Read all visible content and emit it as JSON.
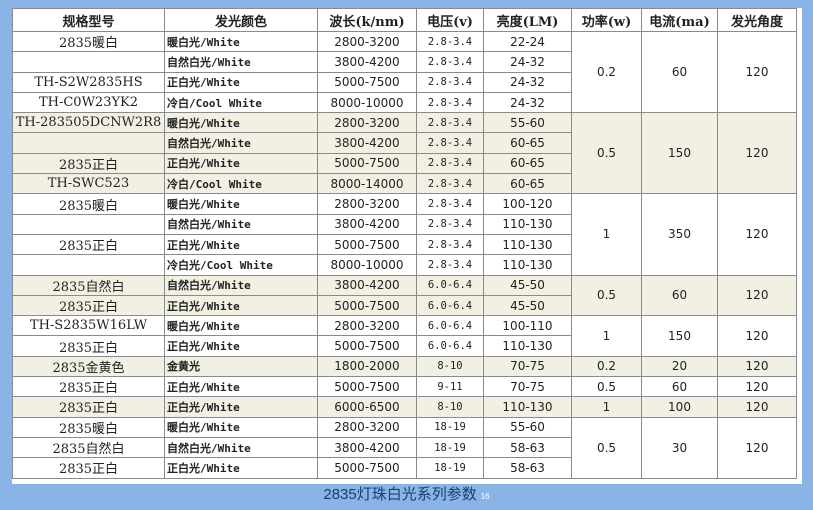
{
  "headers": [
    "规格型号",
    "发光颜色",
    "波长(k/nm)",
    "电压(v)",
    "亮度(LM)",
    "功率(w)",
    "电流(ma)",
    "发光角度"
  ],
  "groups": [
    {
      "power": "0.2",
      "current": "60",
      "angle": "120",
      "rows": [
        {
          "model": "2835暖白",
          "color": "暖白光/White",
          "wave": "2800-3200",
          "volt": "2.8-3.4",
          "lum": "22-24"
        },
        {
          "model": "",
          "color": "自然白光/White",
          "wave": "3800-4200",
          "volt": "2.8-3.4",
          "lum": "24-32"
        },
        {
          "model": "TH-S2W2835HS",
          "color": "正白光/White",
          "wave": "5000-7500",
          "volt": "2.8-3.4",
          "lum": "24-32"
        },
        {
          "model": "TH-C0W23YK2",
          "color": "冷白/Cool White",
          "wave": "8000-10000",
          "volt": "2.8-3.4",
          "lum": "24-32"
        }
      ]
    },
    {
      "power": "0.5",
      "current": "150",
      "angle": "120",
      "rows": [
        {
          "model": "TH-283505DCNW2R8",
          "color": "暖白光/White",
          "wave": "2800-3200",
          "volt": "2.8-3.4",
          "lum": "55-60"
        },
        {
          "model": "",
          "color": "自然白光/White",
          "wave": "3800-4200",
          "volt": "2.8-3.4",
          "lum": "60-65"
        },
        {
          "model": "2835正白",
          "color": "正白光/White",
          "wave": "5000-7500",
          "volt": "2.8-3.4",
          "lum": "60-65"
        },
        {
          "model": "TH-SWC523",
          "color": "冷白/Cool White",
          "wave": "8000-14000",
          "volt": "2.8-3.4",
          "lum": "60-65"
        }
      ]
    },
    {
      "power": "1",
      "current": "350",
      "angle": "120",
      "rows": [
        {
          "model": "2835暖白",
          "color": "暖白光/White",
          "wave": "2800-3200",
          "volt": "2.8-3.4",
          "lum": "100-120"
        },
        {
          "model": "",
          "color": "自然白光/White",
          "wave": "3800-4200",
          "volt": "2.8-3.4",
          "lum": "110-130"
        },
        {
          "model": "2835正白",
          "color": "正白光/White",
          "wave": "5000-7500",
          "volt": "2.8-3.4",
          "lum": "110-130"
        },
        {
          "model": "",
          "color": "冷白光/Cool White",
          "wave": "8000-10000",
          "volt": "2.8-3.4",
          "lum": "110-130"
        }
      ]
    },
    {
      "power": "0.5",
      "current": "60",
      "angle": "120",
      "rows": [
        {
          "model": "2835自然白",
          "color": "自然白光/White",
          "wave": "3800-4200",
          "volt": "6.0-6.4",
          "lum": "45-50"
        },
        {
          "model": "2835正白",
          "color": "正白光/White",
          "wave": "5000-7500",
          "volt": "6.0-6.4",
          "lum": "45-50"
        }
      ]
    },
    {
      "power": "1",
      "current": "150",
      "angle": "120",
      "rows": [
        {
          "model": "TH-S2835W16LW",
          "color": "暖白光/White",
          "wave": "2800-3200",
          "volt": "6.0-6.4",
          "lum": "100-110"
        },
        {
          "model": "2835正白",
          "color": "正白光/White",
          "wave": "5000-7500",
          "volt": "6.0-6.4",
          "lum": "110-130"
        }
      ]
    },
    {
      "power": "0.2",
      "current": "20",
      "angle": "120",
      "rows": [
        {
          "model": "2835金黄色",
          "color": "金黄光",
          "wave": "1800-2000",
          "volt": "8-10",
          "lum": "70-75"
        }
      ]
    },
    {
      "power": "0.5",
      "current": "60",
      "angle": "120",
      "rows": [
        {
          "model": "2835正白",
          "color": "正白光/White",
          "wave": "5000-7500",
          "volt": "9-11",
          "lum": "70-75"
        }
      ]
    },
    {
      "power": "1",
      "current": "100",
      "angle": "120",
      "rows": [
        {
          "model": "2835正白",
          "color": "正白光/White",
          "wave": "6000-6500",
          "volt": "8-10",
          "lum": "110-130"
        }
      ]
    },
    {
      "power": "0.5",
      "current": "30",
      "angle": "120",
      "rows": [
        {
          "model": "2835暖白",
          "color": "暖白光/White",
          "wave": "2800-3200",
          "volt": "18-19",
          "lum": "55-60"
        },
        {
          "model": "2835自然白",
          "color": "自然白光/White",
          "wave": "3800-4200",
          "volt": "18-19",
          "lum": "58-63"
        },
        {
          "model": "2835正白",
          "color": "正白光/White",
          "wave": "5000-7500",
          "volt": "18-19",
          "lum": "58-63"
        }
      ]
    }
  ],
  "caption": "2835灯珠白光系列参数",
  "page_number": "16"
}
